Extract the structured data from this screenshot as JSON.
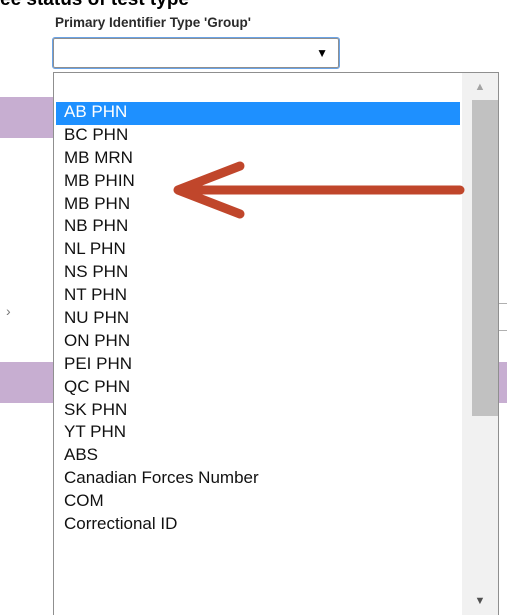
{
  "heading": "ee status of test type",
  "field": {
    "label": "Primary Identifier Type 'Group'",
    "value": "",
    "arrow_glyph": "▼"
  },
  "dropdown": {
    "options": [
      "AB PHN",
      "BC PHN",
      "MB MRN",
      "MB PHIN",
      "MB PHN",
      "NB PHN",
      "NL PHN",
      "NS PHN",
      "NT PHN",
      "NU PHN",
      "ON PHN",
      "PEI PHN",
      "QC PHN",
      "SK PHN",
      "YT PHN",
      "ABS",
      "Canadian Forces Number",
      "COM",
      "Correctional ID"
    ],
    "selected_index": 0,
    "highlight_color": "#1e90ff",
    "annotated_option": "MB PHIN"
  },
  "annotation": {
    "arrow_color": "#c0462b"
  },
  "icons": {
    "scroll_up": "chevron-up-icon",
    "scroll_down": "chevron-down-icon",
    "select": "dropdown-arrow-icon"
  }
}
